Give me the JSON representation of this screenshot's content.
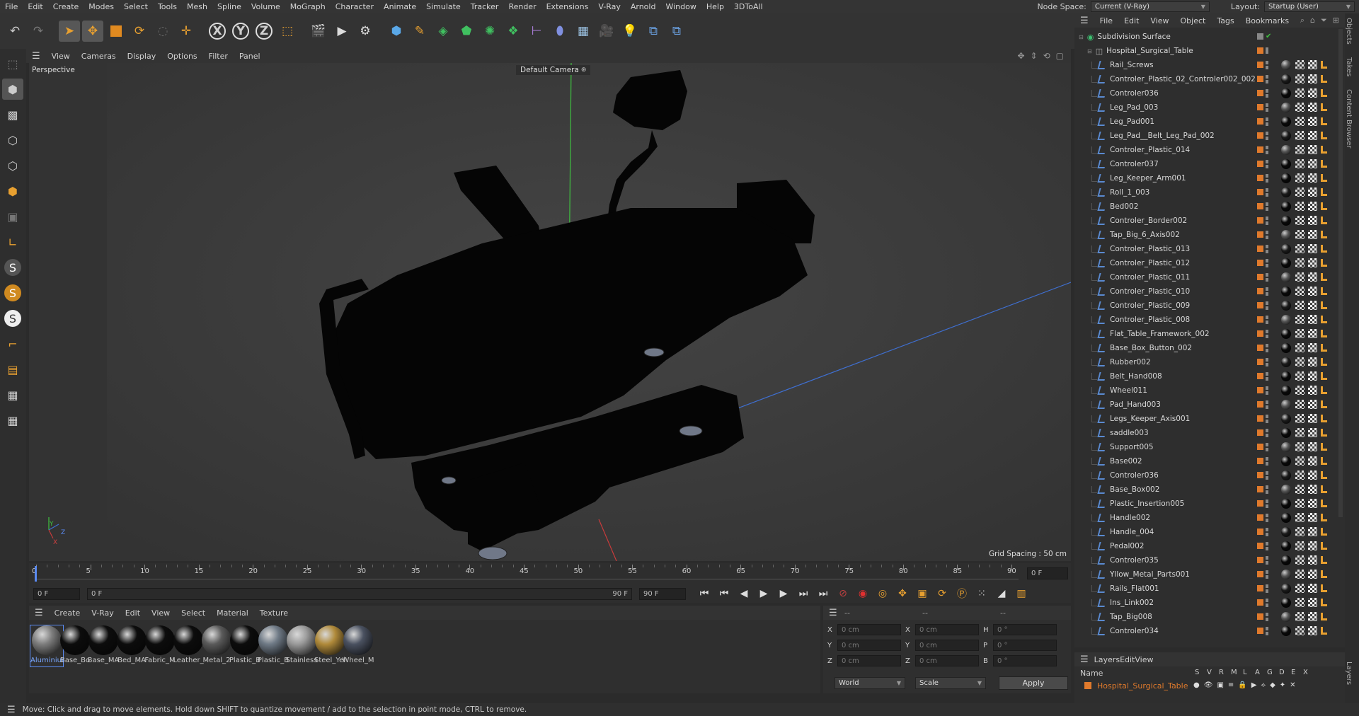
{
  "menu": [
    "File",
    "Edit",
    "Create",
    "Modes",
    "Select",
    "Tools",
    "Mesh",
    "Spline",
    "Volume",
    "MoGraph",
    "Character",
    "Animate",
    "Simulate",
    "Tracker",
    "Render",
    "Extensions",
    "V-Ray",
    "Arnold",
    "Window",
    "Help",
    "3DToAll"
  ],
  "node_space": {
    "label": "Node Space:",
    "value": "Current (V-Ray)"
  },
  "layout": {
    "label": "Layout:",
    "value": "Startup (User)"
  },
  "viewport": {
    "menu": [
      "View",
      "Cameras",
      "Display",
      "Options",
      "Filter",
      "Panel"
    ],
    "name": "Perspective",
    "camera": "Default Camera",
    "grid_spacing": "Grid Spacing : 50 cm",
    "axis": {
      "x": "X",
      "y": "Y",
      "z": "Z"
    }
  },
  "timeline": {
    "ticks": [
      "0",
      "5",
      "10",
      "15",
      "20",
      "25",
      "30",
      "35",
      "40",
      "45",
      "50",
      "55",
      "60",
      "65",
      "70",
      "75",
      "80",
      "85",
      "90"
    ],
    "current_frame": "0 F",
    "start_field": "0 F",
    "range_start": "0 F",
    "range_end": "90 F",
    "end_field": "90 F"
  },
  "materials": {
    "menu": [
      "Create",
      "V-Ray",
      "Edit",
      "View",
      "Select",
      "Material",
      "Texture"
    ],
    "items": [
      {
        "label": "Aluminium",
        "color": "#7d7d7d"
      },
      {
        "label": "Base_Bo",
        "color": "#0c0c0c"
      },
      {
        "label": "Base_MA",
        "color": "#0c0c0c"
      },
      {
        "label": "Bed_MA",
        "color": "#0c0c0c"
      },
      {
        "label": "Fabric_M",
        "color": "#0c0c0c"
      },
      {
        "label": "Leather_",
        "color": "#0c0c0c"
      },
      {
        "label": "Metal_2",
        "color": "#5a5a5a"
      },
      {
        "label": "Plastic_B",
        "color": "#0c0c0c"
      },
      {
        "label": "Plastic_B",
        "color": "#6f7a86"
      },
      {
        "label": "Stainless",
        "color": "#9a9a9a"
      },
      {
        "label": "Steel_Yel",
        "color": "#b08a3a"
      },
      {
        "label": "Wheel_M",
        "color": "#4a5160"
      }
    ]
  },
  "coords": {
    "headers": [
      "--",
      "--",
      "--"
    ],
    "rows": [
      {
        "a": "X",
        "av": "0 cm",
        "b": "X",
        "bv": "0 cm",
        "c": "H",
        "cv": "0 °"
      },
      {
        "a": "Y",
        "av": "0 cm",
        "b": "Y",
        "bv": "0 cm",
        "c": "P",
        "cv": "0 °"
      },
      {
        "a": "Z",
        "av": "0 cm",
        "b": "Z",
        "bv": "0 cm",
        "c": "B",
        "cv": "0 °"
      }
    ],
    "space": "World",
    "mode": "Scale",
    "apply": "Apply"
  },
  "status": "Move: Click and drag to move elements. Hold down SHIFT to quantize movement / add to the selection in point mode, CTRL to remove.",
  "objects": {
    "menu": [
      "File",
      "Edit",
      "View",
      "Object",
      "Tags",
      "Bookmarks"
    ],
    "root": "Subdivision Surface",
    "group": "Hospital_Surgical_Table",
    "items": [
      "Rail_Screws",
      "Controler_Plastic_02_Controler002_002",
      "Controler036",
      "Leg_Pad_003",
      "Leg_Pad001",
      "Leg_Pad__Belt_Leg_Pad_002",
      "Controler_Plastic_014",
      "Controler037",
      "Leg_Keeper_Arm001",
      "Roll_1_003",
      "Bed002",
      "Controler_Border002",
      "Tap_Big_6_Axis002",
      "Controler_Plastic_013",
      "Controler_Plastic_012",
      "Controler_Plastic_011",
      "Controler_Plastic_010",
      "Controler_Plastic_009",
      "Controler_Plastic_008",
      "Flat_Table_Framework_002",
      "Base_Box_Button_002",
      "Rubber002",
      "Belt_Hand008",
      "Wheel011",
      "Pad_Hand003",
      "Legs_Keeper_Axis001",
      "saddle003",
      "Support005",
      "Base002",
      "Controler036",
      "Base_Box002",
      "Plastic_Insertion005",
      "Handle002",
      "Handle_004",
      "Pedal002",
      "Controler035",
      "Yllow_Metal_Parts001",
      "Rails_Flat001",
      "Ins_Link002",
      "Tap_Big008",
      "Controler034"
    ]
  },
  "layers": {
    "menu": [
      "Layers",
      "Edit",
      "View"
    ],
    "header": {
      "name": "Name",
      "cols": [
        "S",
        "V",
        "R",
        "M",
        "L",
        "A",
        "G",
        "D",
        "E",
        "X"
      ]
    },
    "row": "Hospital_Surgical_Table",
    "color": "#e07a2c"
  },
  "side_tabs": [
    "Objects",
    "Takes",
    "Content Browser",
    "Layers"
  ],
  "colors": {
    "accent": "#e07a2c",
    "axis_x": "#c83b3b",
    "axis_y": "#3fc040",
    "axis_z": "#3f6fd0"
  }
}
